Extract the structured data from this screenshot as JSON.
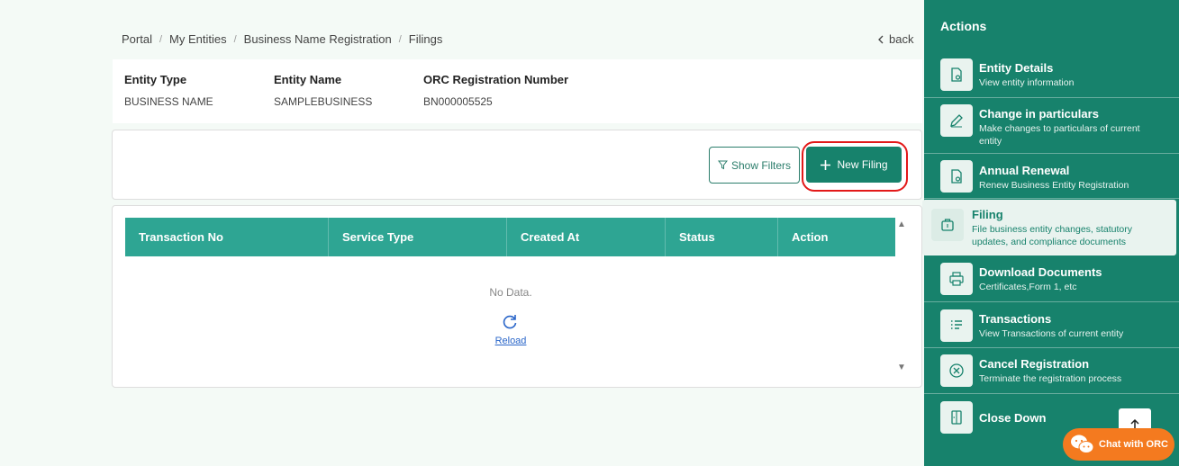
{
  "breadcrumb": {
    "items": [
      "Portal",
      "My Entities",
      "Business Name Registration",
      "Filings"
    ],
    "separator": "/"
  },
  "back_label": "back",
  "entity": {
    "type_label": "Entity Type",
    "type_value": "BUSINESS NAME",
    "name_label": "Entity Name",
    "name_value": "SAMPLEBUSINESS",
    "orc_label": "ORC Registration Number",
    "orc_value": "BN000005525"
  },
  "toolbar": {
    "filters_label": "Show Filters",
    "new_filing_label": "New Filing"
  },
  "table": {
    "columns": [
      "Transaction No",
      "Service Type",
      "Created At",
      "Status",
      "Action"
    ],
    "empty_text": "No Data.",
    "reload_label": "Reload"
  },
  "sidebar": {
    "title": "Actions",
    "items": [
      {
        "title": "Entity Details",
        "desc": "View entity information",
        "icon": "file-view-icon"
      },
      {
        "title": "Change in particulars",
        "desc": "Make changes to particulars of current entity",
        "icon": "pencil-icon"
      },
      {
        "title": "Annual Renewal",
        "desc": "Renew Business Entity Registration",
        "icon": "file-view-icon"
      },
      {
        "title": "Filing",
        "desc": "File business entity changes, statutory updates, and compliance documents",
        "icon": "briefcase-icon"
      },
      {
        "title": "Download Documents",
        "desc": "Certificates,Form 1, etc",
        "icon": "printer-icon"
      },
      {
        "title": "Transactions",
        "desc": "View Transactions of current entity",
        "icon": "list-icon"
      },
      {
        "title": "Cancel Registration",
        "desc": "Terminate the registration process",
        "icon": "cancel-circle-icon"
      },
      {
        "title": "Close Down",
        "desc": "",
        "icon": "door-icon"
      }
    ]
  },
  "chat_label": "Chat with ORC",
  "colors": {
    "primary": "#17826c",
    "table_header": "#2ea593",
    "highlight": "#e31919",
    "chat": "#f47a1f"
  }
}
